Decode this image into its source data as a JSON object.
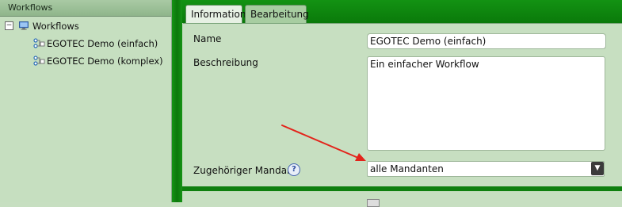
{
  "left_panel": {
    "header": "Workflows",
    "tree": {
      "expander": "−",
      "root_label": "Workflows",
      "items": [
        {
          "label": "EGOTEC Demo (einfach)"
        },
        {
          "label": "EGOTEC Demo (komplex)"
        }
      ]
    }
  },
  "tabs": [
    {
      "label": "Information",
      "active": true
    },
    {
      "label": "Bearbeitung",
      "active": false
    }
  ],
  "form": {
    "name_label": "Name",
    "name_value": "EGOTEC Demo (einfach)",
    "beschreibung_label": "Beschreibung",
    "beschreibung_value": "Ein einfacher Workflow",
    "mandant_label": "Zugehöriger Mandant",
    "help_icon": "?",
    "mandant_value": "alle Mandanten",
    "dropdown_icon": "▼"
  },
  "annotation": {
    "color": "#e3241b"
  },
  "colors": {
    "accent_green": "#0c7f0c",
    "panel_green": "#c7dfc1"
  }
}
